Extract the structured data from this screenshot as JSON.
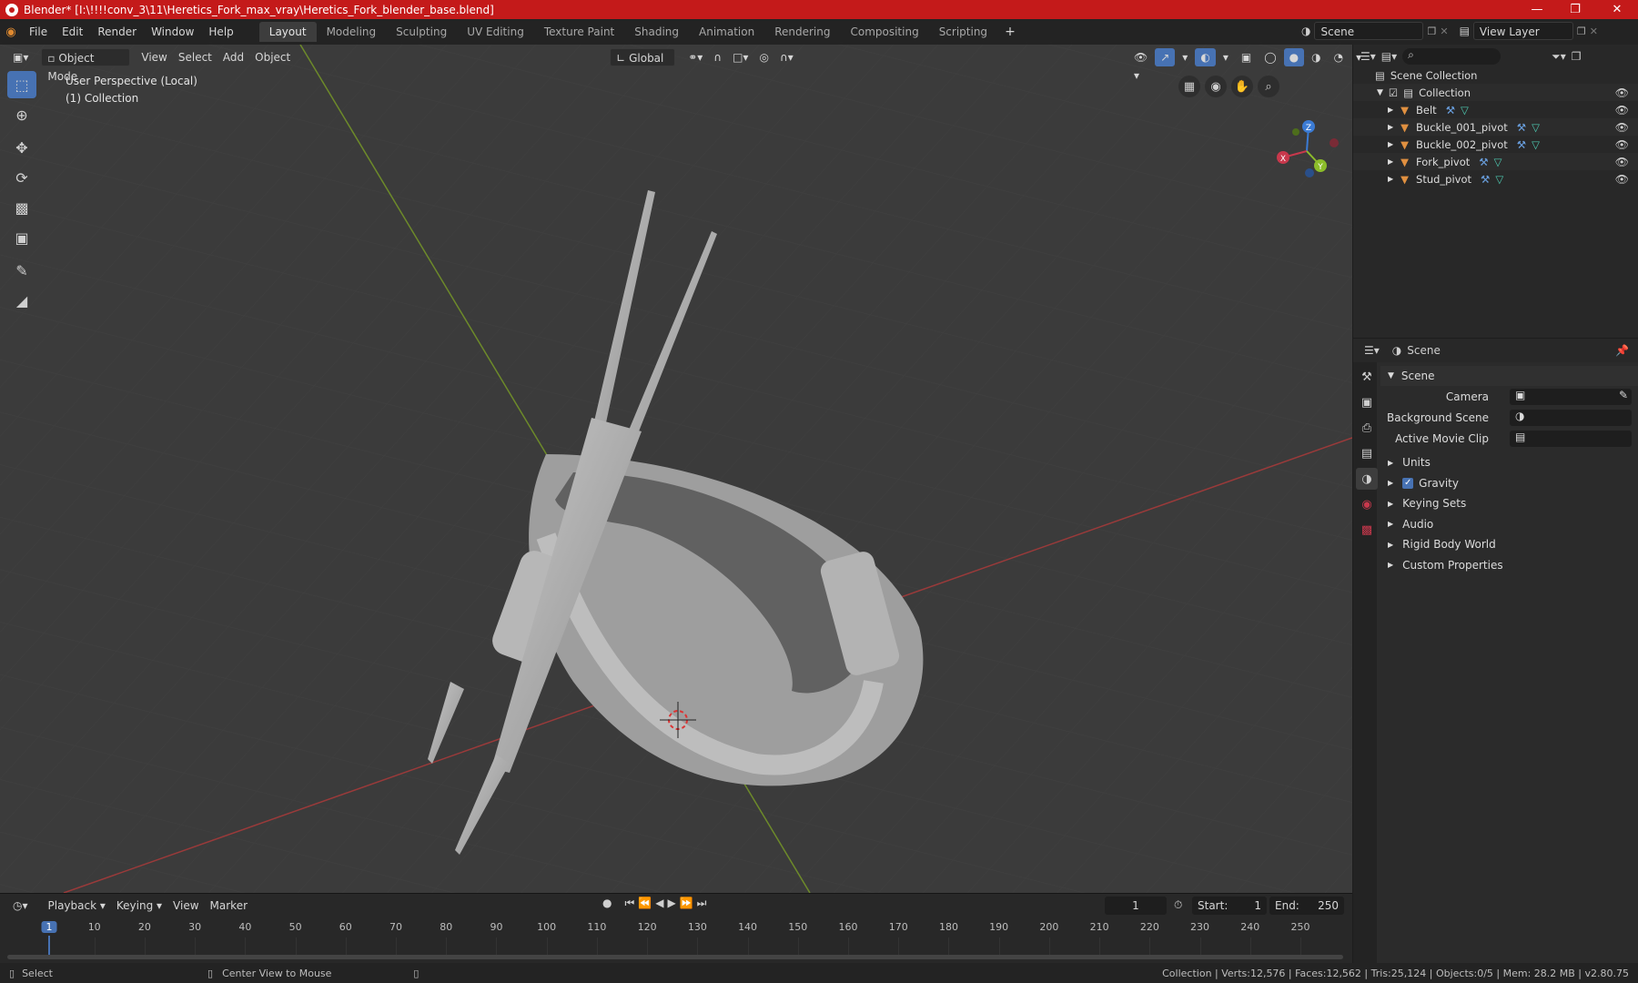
{
  "title_bar": {
    "title": "Blender* [I:\\!!!!conv_3\\11\\Heretics_Fork_max_vray\\Heretics_Fork_blender_base.blend]"
  },
  "menu": [
    "File",
    "Edit",
    "Render",
    "Window",
    "Help"
  ],
  "workspaces": [
    "Layout",
    "Modeling",
    "Sculpting",
    "UV Editing",
    "Texture Paint",
    "Shading",
    "Animation",
    "Rendering",
    "Compositing",
    "Scripting"
  ],
  "active_workspace": "Layout",
  "scene_field": "Scene",
  "view_layer_field": "View Layer",
  "viewport_header": {
    "mode": "Object Mode",
    "menus": [
      "View",
      "Select",
      "Add",
      "Object"
    ],
    "transform": "Global"
  },
  "viewport_info": {
    "perspective": "User Perspective (Local)",
    "collection": "(1) Collection"
  },
  "gizmo": {
    "x": "X",
    "y": "Y",
    "z": "Z"
  },
  "outliner": {
    "scene_collection": "Scene Collection",
    "collection": "Collection",
    "objects": [
      "Belt",
      "Buckle_001_pivot",
      "Buckle_002_pivot",
      "Fork_pivot",
      "Stud_pivot"
    ]
  },
  "properties": {
    "header": "Scene",
    "panel": "Scene",
    "camera_label": "Camera",
    "background_scene_label": "Background Scene",
    "active_movie_clip_label": "Active Movie Clip",
    "sections": [
      "Units",
      "Gravity",
      "Keying Sets",
      "Audio",
      "Rigid Body World",
      "Custom Properties"
    ],
    "gravity_checked": true
  },
  "timeline": {
    "menus": [
      "Playback",
      "Keying",
      "View",
      "Marker"
    ],
    "current_frame": "1",
    "start_label": "Start:",
    "start": "1",
    "end_label": "End:",
    "end": "250",
    "ticks": [
      "1",
      "10",
      "20",
      "30",
      "40",
      "50",
      "60",
      "70",
      "80",
      "90",
      "100",
      "110",
      "120",
      "130",
      "140",
      "150",
      "160",
      "170",
      "180",
      "190",
      "200",
      "210",
      "220",
      "230",
      "240",
      "250"
    ]
  },
  "status": {
    "left": "Select",
    "middle": "Center View to Mouse",
    "right": "Collection | Verts:12,576 | Faces:12,562 | Tris:25,124 | Objects:0/5 | Mem: 28.2 MB | v2.80.75"
  },
  "colors": {
    "title_bar": "#c41a1a",
    "accent": "#4772b3",
    "x_axis": "#c8384c",
    "y_axis": "#8cbd2a",
    "z_axis": "#3b7bd4",
    "object_icon": "#e09040"
  }
}
